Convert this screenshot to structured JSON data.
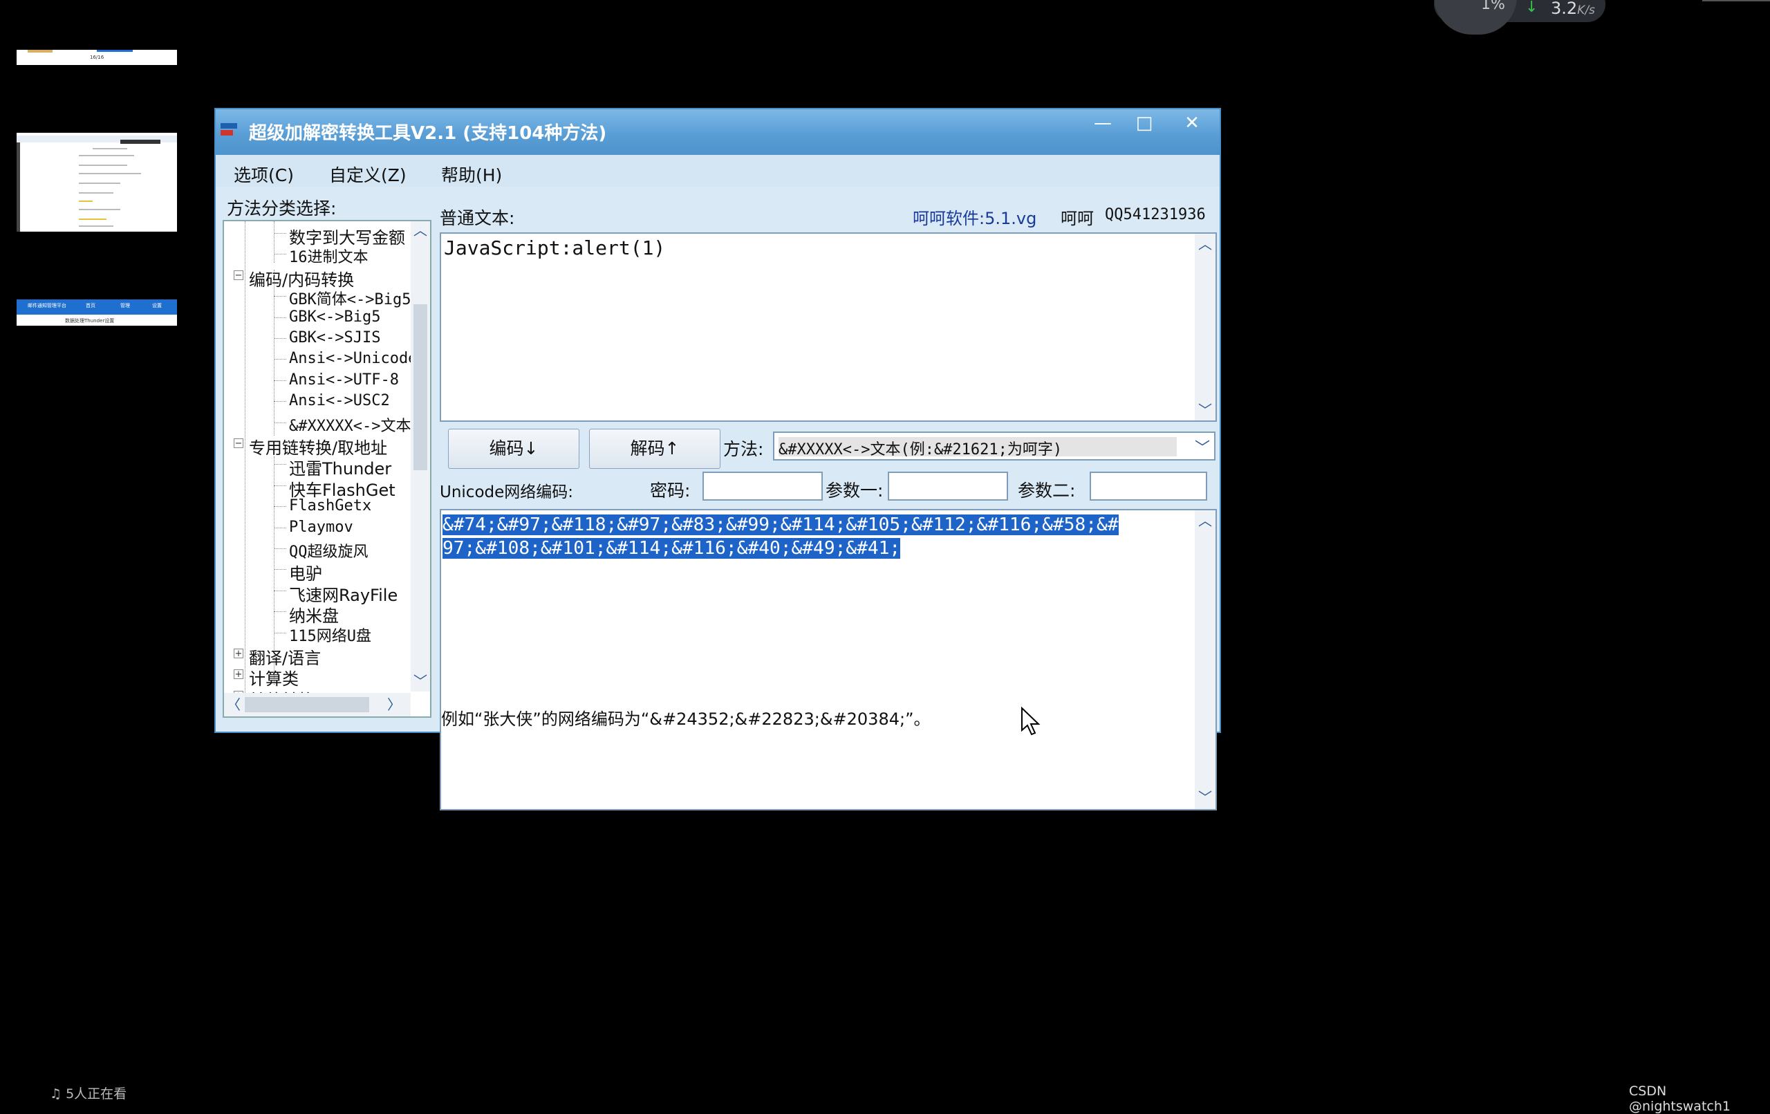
{
  "thumbnails": {
    "t1_text": "16/16",
    "t3_items": [
      "邮件通知管理平台",
      "首页",
      "管理",
      "设置"
    ],
    "t3_sub": "数据处理Thunder设置"
  },
  "network": {
    "percent": "1%",
    "arrow": "↓",
    "speed": "3.2",
    "unit": "K/s"
  },
  "window": {
    "title": "超级加解密转换工具V2.1 (支持104种方法)",
    "buttons": {
      "min": "—",
      "max": "□",
      "close": "✕"
    },
    "menu": [
      "选项(C)",
      "自定义(Z)",
      "帮助(H)"
    ]
  },
  "left": {
    "label": "方法分类选择:",
    "tree": [
      {
        "text": "数字到大写金额",
        "level": 2
      },
      {
        "text": "16进制文本",
        "level": 2
      },
      {
        "text": "编码/内码转换",
        "level": 1,
        "expanded": true
      },
      {
        "text": "GBK简体<->Big5",
        "level": 2
      },
      {
        "text": "GBK<->Big5",
        "level": 2
      },
      {
        "text": "GBK<->SJIS",
        "level": 2
      },
      {
        "text": "Ansi<->Unicode",
        "level": 2
      },
      {
        "text": "Ansi<->UTF-8",
        "level": 2
      },
      {
        "text": "Ansi<->USC2",
        "level": 2
      },
      {
        "text": "&#XXXXX<->文本",
        "level": 2
      },
      {
        "text": "专用链转换/取地址",
        "level": 1,
        "expanded": true
      },
      {
        "text": "迅雷Thunder",
        "level": 2
      },
      {
        "text": "快车FlashGet",
        "level": 2
      },
      {
        "text": "FlashGetx",
        "level": 2
      },
      {
        "text": "Playmov",
        "level": 2
      },
      {
        "text": "QQ超级旋风",
        "level": 2
      },
      {
        "text": "电驴",
        "level": 2
      },
      {
        "text": "飞速网RayFile",
        "level": 2
      },
      {
        "text": "纳米盘",
        "level": 2
      },
      {
        "text": "115网络U盘",
        "level": 2
      },
      {
        "text": "翻译/语言",
        "level": 1,
        "expanded": false
      },
      {
        "text": "计算类",
        "level": 1,
        "expanded": false
      },
      {
        "text": "其他转换",
        "level": 1,
        "expanded": false
      }
    ]
  },
  "right": {
    "plain_label": "普通文本:",
    "vendor": "呵呵软件:5.1.vg",
    "vendor2": "呵呵",
    "qq": "QQ541231936",
    "plain_text": "JavaScript:alert(1)",
    "encode_btn": "编码↓",
    "decode_btn": "解码↑",
    "method_label": "方法:",
    "method_value": "&#XXXXX<->文本(例:&#21621;为呵字)",
    "encoded_label": "Unicode网络编码:",
    "password_label": "密码:",
    "param1_label": "参数一:",
    "param2_label": "参数二:",
    "password_value": "",
    "param1_value": "",
    "param2_value": "",
    "encoded_line1": "&#74;&#97;&#118;&#97;&#83;&#99;&#114;&#105;&#112;&#116;&#58;&#",
    "encoded_line2": "97;&#108;&#101;&#114;&#116;&#40;&#49;&#41;",
    "hint": "例如“张大侠”的网络编码为“&#24352;&#22823;&#20384;”。"
  },
  "footer": {
    "viewers": "5人正在看",
    "credit": "CSDN @nightswatch1"
  },
  "colors": {
    "titlebar": "#5a9ed6",
    "window_bg": "#d9eaf6",
    "selection": "#1e64c8",
    "vendor_text": "#1a3a9a"
  }
}
